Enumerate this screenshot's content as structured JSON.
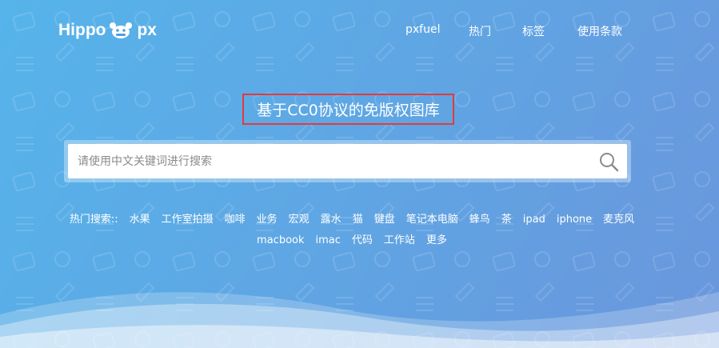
{
  "brand": {
    "name_left": "Hippo",
    "name_right": "px"
  },
  "nav": {
    "items": [
      "pxfuel",
      "热门",
      "标签",
      "使用条款"
    ]
  },
  "hero": {
    "headline": "基于CC0协议的免版权图库"
  },
  "search": {
    "placeholder": "请使用中文关键词进行搜索"
  },
  "hot_searches": {
    "label": "热门搜索::",
    "tags": [
      "水果",
      "工作室拍摄",
      "咖啡",
      "业务",
      "宏观",
      "露水",
      "猫",
      "键盘",
      "笔记本电脑",
      "蜂鸟",
      "茶",
      "ipad",
      "iphone",
      "麦克风",
      "macbook",
      "imac",
      "代码",
      "工作站",
      "更多"
    ]
  },
  "icons": {
    "logo": "hippo-logo-icon",
    "search": "magnifier-icon"
  },
  "colors": {
    "bg_start": "#56b4ea",
    "bg_end": "#6a96dc",
    "highlight_border": "#e23b3b",
    "text": "#ffffff"
  }
}
